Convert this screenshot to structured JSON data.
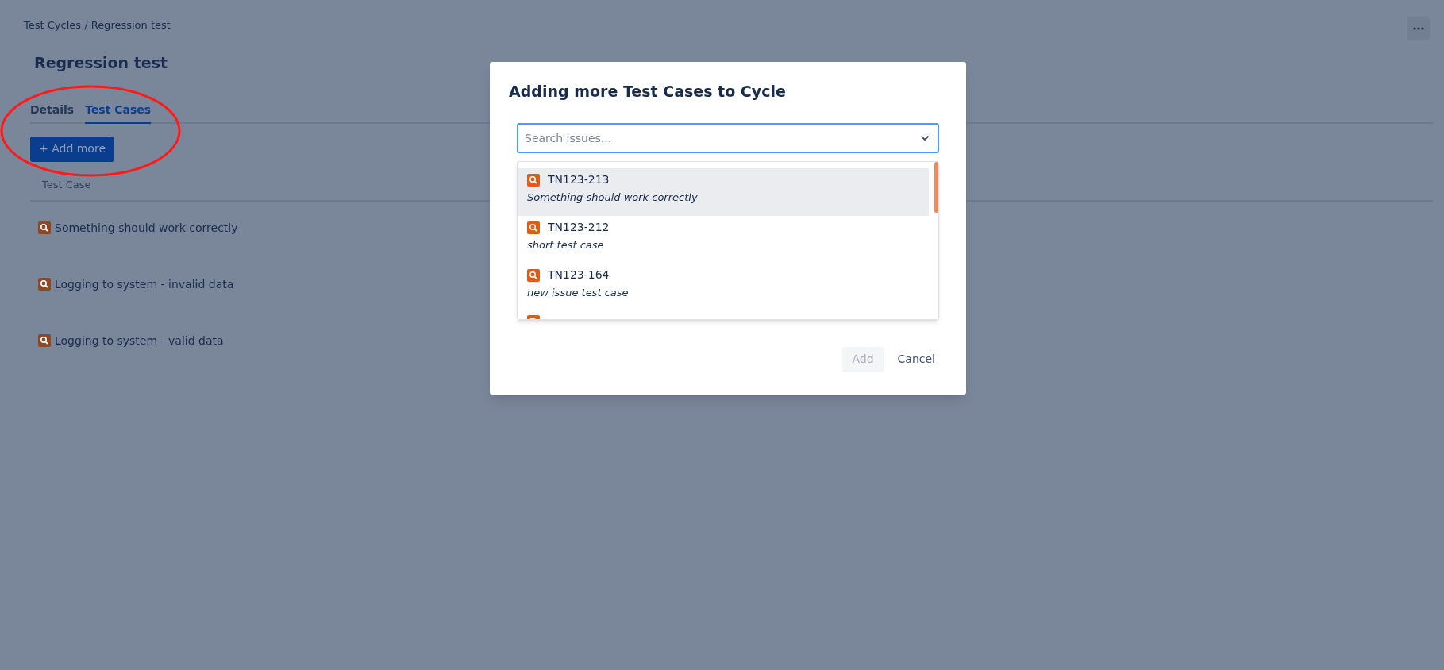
{
  "breadcrumb": "Test Cycles / Regression test",
  "title": "Regression test",
  "tabs": [
    {
      "label": "Details",
      "selected": false
    },
    {
      "label": "Test Cases",
      "selected": true
    }
  ],
  "add_button": "+ Add more",
  "table": {
    "columns": [
      "Test Case"
    ],
    "rows": [
      {
        "title": "Something should work correctly"
      },
      {
        "title": "Logging to system - invalid data"
      },
      {
        "title": "Logging to system - valid data"
      }
    ]
  },
  "dialog": {
    "title": "Adding more Test Cases to Cycle",
    "search": {
      "placeholder": "Search issues..."
    },
    "options": [
      {
        "key": "TN123-213",
        "summary": "Something should work correctly",
        "selected": true
      },
      {
        "key": "TN123-212",
        "summary": "short test case",
        "selected": false
      },
      {
        "key": "TN123-164",
        "summary": "new issue test case",
        "selected": false
      },
      {
        "selected": false
      }
    ],
    "buttons": [
      {
        "label": "Add",
        "disabled": true
      },
      {
        "label": "Cancel",
        "disabled": false
      }
    ]
  }
}
